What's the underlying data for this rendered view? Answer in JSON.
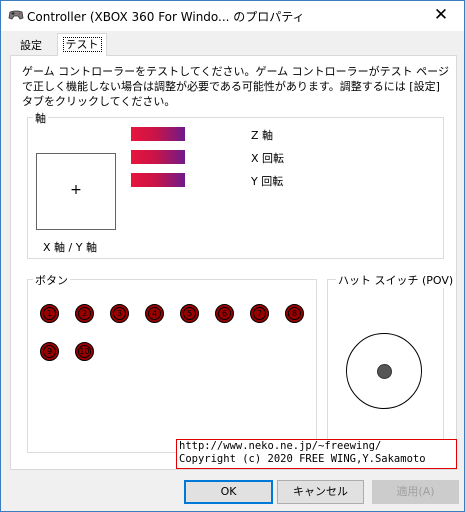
{
  "window": {
    "title": "Controller (XBOX 360 For Windo... のプロパティ",
    "icon": "game-controller-icon",
    "close_glyph": "✕"
  },
  "tabs": [
    {
      "label": "設定",
      "active": false
    },
    {
      "label": "テスト",
      "active": true
    }
  ],
  "description": "ゲーム コントローラーをテストしてください。ゲーム コントローラーがテスト ページで正しく機能しない場合は調整が必要である可能性があります。調整するには [設定] タブをクリックしてください。",
  "axes_group": {
    "label": "軸",
    "xy_label": "X 軸 / Y 軸",
    "crosshair": "+",
    "bars": [
      {
        "label": "Z 軸"
      },
      {
        "label": "X 回転"
      },
      {
        "label": "Y 回転"
      }
    ]
  },
  "buttons_group": {
    "label": "ボタン",
    "buttons": [
      "1",
      "2",
      "3",
      "4",
      "5",
      "6",
      "7",
      "8",
      "9",
      "10"
    ],
    "pressed_color": "#9b0000"
  },
  "pov_group": {
    "label": "ハット スイッチ (POV)"
  },
  "credit": {
    "line1": "http://www.neko.ne.jp/~freewing/",
    "line2": "Copyright (c) 2020 FREE WING,Y.Sakamoto"
  },
  "dialog_buttons": {
    "ok": "OK",
    "cancel": "キャンセル",
    "apply": "適用(A)"
  },
  "colors": {
    "accent": "#0078d7",
    "credit_border": "#e00000",
    "bar_start": "#e8153c",
    "bar_end": "#6f1a8a"
  }
}
